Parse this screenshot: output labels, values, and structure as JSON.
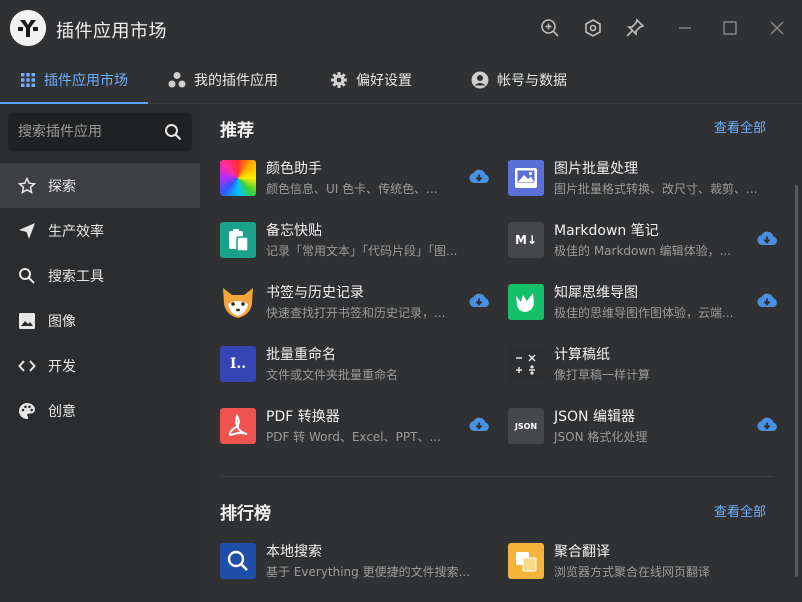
{
  "app": {
    "title": "插件应用市场"
  },
  "tabs": [
    {
      "label": "插件应用市场",
      "icon": "grid-icon"
    },
    {
      "label": "我的插件应用",
      "icon": "apps-icon"
    },
    {
      "label": "偏好设置",
      "icon": "gear-icon"
    },
    {
      "label": "帐号与数据",
      "icon": "account-icon"
    }
  ],
  "search": {
    "placeholder": "搜索插件应用"
  },
  "sidebar": {
    "items": [
      {
        "label": "探索",
        "icon": "star-icon"
      },
      {
        "label": "生产效率",
        "icon": "send-icon"
      },
      {
        "label": "搜索工具",
        "icon": "search-icon"
      },
      {
        "label": "图像",
        "icon": "image-icon"
      },
      {
        "label": "开发",
        "icon": "code-icon"
      },
      {
        "label": "创意",
        "icon": "palette-icon"
      }
    ]
  },
  "recommend": {
    "title": "推荐",
    "view_all": "查看全部",
    "items": [
      {
        "name": "颜色助手",
        "desc": "颜色信息、UI 色卡、传统色、...",
        "icon": "color-wheel-icon"
      },
      {
        "name": "图片批量处理",
        "desc": "图片批量格式转换、改尺寸、裁剪、...",
        "icon": "picture-icon"
      },
      {
        "name": "备忘快贴",
        "desc": "记录「常用文本」「代码片段」「图...",
        "icon": "clipboard-icon"
      },
      {
        "name": "Markdown 笔记",
        "desc": "极佳的 Markdown 编辑体验，...",
        "icon": "markdown-icon"
      },
      {
        "name": "书签与历史记录",
        "desc": "快速查找打开书签和历史记录，...",
        "icon": "fox-icon"
      },
      {
        "name": "知犀思维导图",
        "desc": "极佳的思维导图作图体验，云端...",
        "icon": "rhino-icon"
      },
      {
        "name": "批量重命名",
        "desc": "文件或文件夹批量重命名",
        "icon": "rename-icon"
      },
      {
        "name": "计算稿纸",
        "desc": "像打草稿一样计算",
        "icon": "calculator-icon"
      },
      {
        "name": "PDF 转换器",
        "desc": "PDF 转 Word、Excel、PPT、...",
        "icon": "pdf-icon"
      },
      {
        "name": "JSON 编辑器",
        "desc": "JSON 格式化处理",
        "icon": "json-icon"
      }
    ]
  },
  "ranking": {
    "title": "排行榜",
    "view_all": "查看全部",
    "items": [
      {
        "name": "本地搜索",
        "desc": "基于 Everything 更便捷的文件搜索...",
        "icon": "local-search-icon"
      },
      {
        "name": "聚合翻译",
        "desc": "浏览器方式聚合在线网页翻译",
        "icon": "translate-icon"
      }
    ]
  },
  "icon_text": {
    "markdown": "M↓",
    "json": "JSON",
    "rename": "I..",
    "calc": "− ×\n+ ÷"
  },
  "colors": {
    "accent": "#5aa3ff",
    "background": "#303133",
    "sidebar": "#2b2c2e"
  }
}
